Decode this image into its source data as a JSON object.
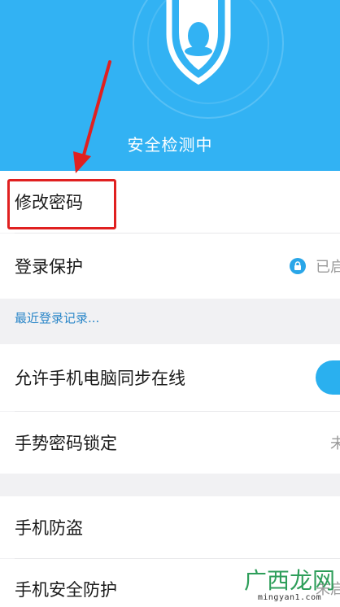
{
  "header": {
    "background_color": "#32b2f3",
    "status_text": "安全检测中",
    "shield_icon": "qq-penguin-shield-icon"
  },
  "rows": {
    "change_password": {
      "label": "修改密码"
    },
    "login_protection": {
      "label": "登录保护",
      "status": "已启",
      "status_icon": "lock-icon"
    },
    "recent_login_link": "最近登录记录...",
    "allow_phone_pc_online": {
      "label": "允许手机电脑同步在线",
      "toggle_on": true
    },
    "gesture_password_lock": {
      "label": "手势密码锁定",
      "status": "未"
    },
    "phone_anti_theft": {
      "label": "手机防盗"
    },
    "phone_security_protection": {
      "label": "手机安全防护",
      "status": "未启"
    }
  },
  "annotation": {
    "color": "#e02020",
    "highlighted_item": "修改密码"
  },
  "watermark": {
    "brand": "广西龙网",
    "url": "mingyan1.com"
  }
}
